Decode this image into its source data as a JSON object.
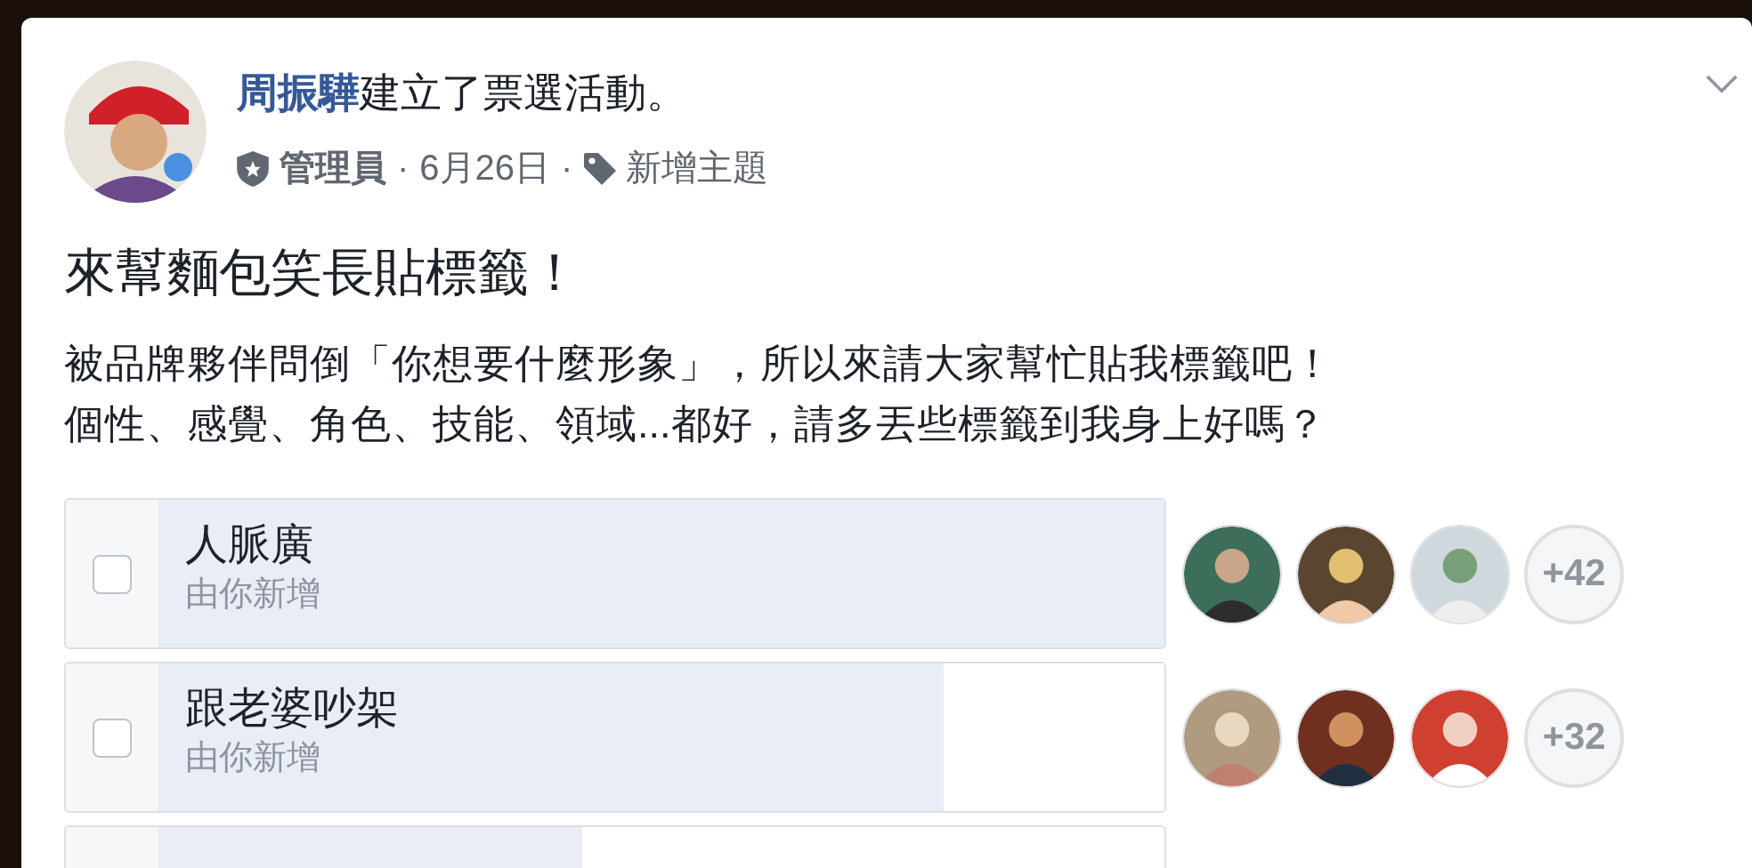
{
  "post": {
    "author": "周振驊",
    "action": "建立了票選活動。",
    "role": "管理員",
    "separator": "·",
    "date": "6月26日",
    "separator_2": "·",
    "topic": "新增主題",
    "title": "來幫麵包笑長貼標籤！",
    "body": [
      "被品牌夥伴問倒「你想要什麼形象」，所以來請大家幫忙貼我標籤吧！",
      "個性、感覺、角色、技能、領域...都好，請多丟些標籤到我身上好嗎？"
    ]
  },
  "options": [
    {
      "label": "人脈廣",
      "added_by": "由你新增",
      "checked": false,
      "level": 1.0,
      "more": "+42"
    },
    {
      "label": "跟老婆吵架",
      "added_by": "由你新增",
      "checked": false,
      "level": 0.78,
      "more": "+32"
    },
    {
      "level": 0.42
    }
  ]
}
